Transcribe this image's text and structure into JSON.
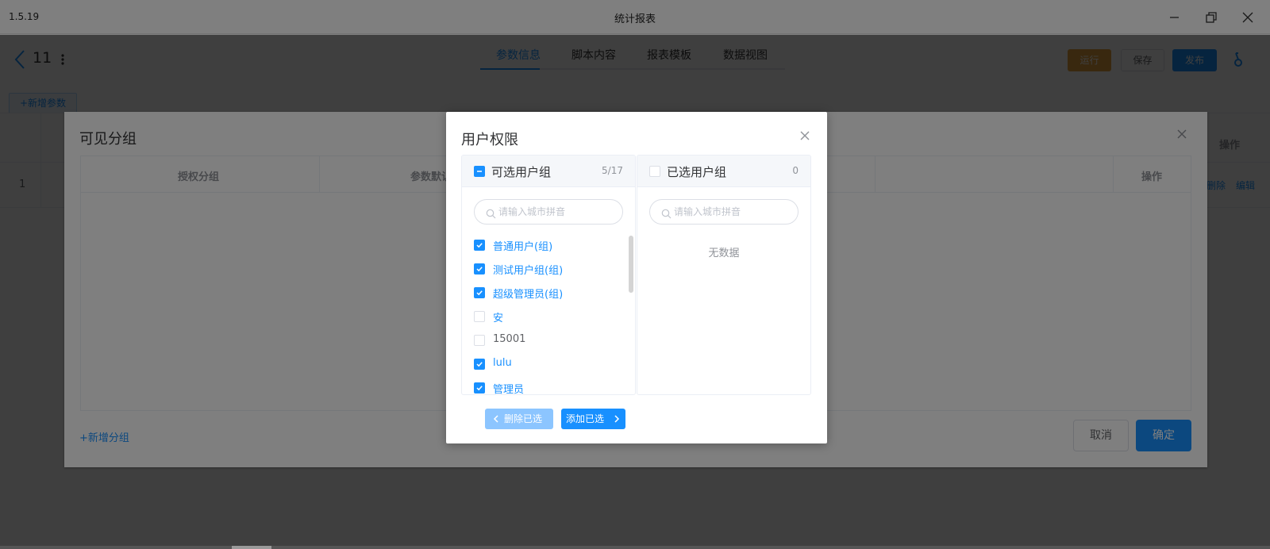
{
  "window": {
    "version": "1.5.19",
    "title": "统计报表",
    "controls": [
      "minimize-icon",
      "restore-icon",
      "close-icon"
    ]
  },
  "toolbar": {
    "doc_title": "11",
    "tabs": [
      {
        "label": "参数信息",
        "active": true
      },
      {
        "label": "脚本内容",
        "active": false
      },
      {
        "label": "报表模板",
        "active": false
      },
      {
        "label": "数据视图",
        "active": false
      }
    ],
    "run_label": "运行",
    "save_label": "保存",
    "publish_label": "发布"
  },
  "params": {
    "add_label": "+新增参数",
    "row_index": "1",
    "op_header": "操作",
    "delete_label": "删除",
    "edit_label": "编辑"
  },
  "group_dialog": {
    "title": "可见分组",
    "columns": [
      "授权分组",
      "参数默认",
      "操作"
    ],
    "add_group_label": "+新增分组",
    "cancel_label": "取消",
    "confirm_label": "确定"
  },
  "user_dialog": {
    "title": "用户权限",
    "left_panel": {
      "title": "可选用户组",
      "count": "5/17",
      "search_placeholder": "请输入城市拼音",
      "items": [
        {
          "label": "普通用户(组)",
          "checked": true
        },
        {
          "label": "测试用户组(组)",
          "checked": true
        },
        {
          "label": "超级管理员(组)",
          "checked": true
        },
        {
          "label": "安",
          "checked": false
        },
        {
          "label": "15001",
          "checked": false
        },
        {
          "label": "lulu",
          "checked": true
        },
        {
          "label": "管理员",
          "checked": true
        }
      ]
    },
    "right_panel": {
      "title": "已选用户组",
      "count": "0",
      "search_placeholder": "请输入城市拼音",
      "empty_text": "无数据"
    },
    "remove_label": "删除已选",
    "add_label": "添加已选"
  },
  "colors": {
    "primary": "#1890ff",
    "warning": "#e6a23c"
  }
}
